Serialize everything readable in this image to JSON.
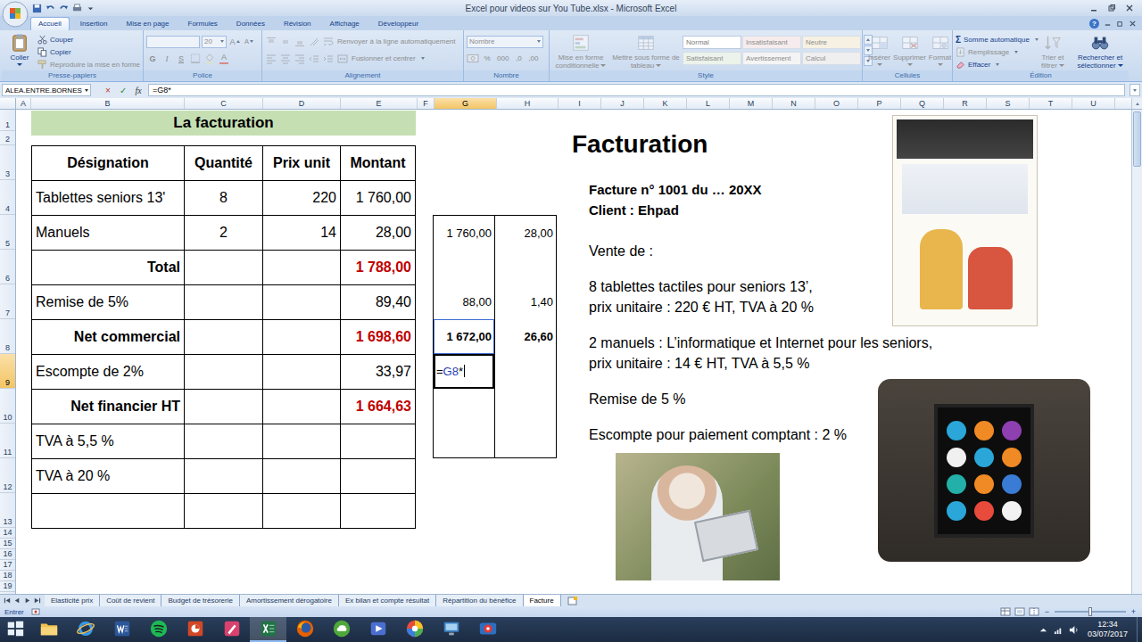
{
  "window": {
    "title": "Excel pour videos sur You Tube.xlsx - Microsoft Excel"
  },
  "ribbon_tabs": [
    {
      "label": "Accueil",
      "selected": true
    },
    {
      "label": "Insertion",
      "selected": false
    },
    {
      "label": "Mise en page",
      "selected": false
    },
    {
      "label": "Formules",
      "selected": false
    },
    {
      "label": "Données",
      "selected": false
    },
    {
      "label": "Révision",
      "selected": false
    },
    {
      "label": "Affichage",
      "selected": false
    },
    {
      "label": "Développeur",
      "selected": false
    }
  ],
  "help": "?",
  "ribbon": {
    "clipboard": {
      "label": "Presse-papiers",
      "paste": {
        "label": "Coller",
        "disabled": false
      },
      "items": [
        {
          "label": "Couper",
          "disabled": false
        },
        {
          "label": "Copier",
          "disabled": false
        },
        {
          "label": "Reproduire la mise en forme",
          "disabled": true
        }
      ]
    },
    "font": {
      "label": "Police",
      "name": "",
      "size": "20",
      "grow": "A",
      "shrink": "A",
      "bold": "G",
      "italic": "I",
      "underline": "S",
      "color_letter": "A",
      "disabled": true
    },
    "alignment": {
      "label": "Alignement",
      "wrap": "Renvoyer à la ligne automatiquement",
      "merge": "Fusionner et centrer",
      "disabled": true
    },
    "number": {
      "label": "Nombre",
      "format": "Nombre",
      "symbols": [
        "%",
        "000",
        ",0",
        ",00"
      ],
      "disabled": true
    },
    "styles": {
      "label": "Style",
      "buttons": [
        "Mise en forme conditionnelle",
        "Mettre sous forme de tableau"
      ],
      "gallery": [
        {
          "label": "Normal",
          "selected": true,
          "color": "#ffffff"
        },
        {
          "label": "Insatisfaisant",
          "selected": false,
          "color": "#f6eced"
        },
        {
          "label": "Neutre",
          "selected": false,
          "color": "#f6f1e2"
        },
        {
          "label": "Satisfaisant",
          "selected": false,
          "color": "#ebf3eb"
        },
        {
          "label": "Avertissement",
          "selected": false,
          "color": "#f4f4f4"
        },
        {
          "label": "Calcul",
          "selected": false,
          "color": "#efefef"
        }
      ],
      "disabled": true
    },
    "cells": {
      "label": "Cellules",
      "buttons": [
        "Insérer",
        "Supprimer",
        "Format"
      ],
      "disabled": true
    },
    "editing": {
      "label": "Édition",
      "sum_symbol": "Σ",
      "items": [
        {
          "label": "Somme automatique",
          "disabled": false
        },
        {
          "label": "Remplissage",
          "disabled": true
        },
        {
          "label": "Effacer",
          "disabled": false
        }
      ],
      "buttons": [
        {
          "label": "Trier et filtrer",
          "disabled": true
        },
        {
          "label": "Rechercher et sélectionner",
          "disabled": false
        }
      ]
    }
  },
  "formula_bar": {
    "name_box": "ALEA.ENTRE.BORNES",
    "cancel": "×",
    "enter": "✓",
    "fx": "fx",
    "formula": "=G8*"
  },
  "columns": [
    {
      "letter": "A",
      "selected": false
    },
    {
      "letter": "B",
      "selected": false
    },
    {
      "letter": "C",
      "selected": false
    },
    {
      "letter": "D",
      "selected": false
    },
    {
      "letter": "E",
      "selected": false
    },
    {
      "letter": "F",
      "selected": false
    },
    {
      "letter": "G",
      "selected": true
    },
    {
      "letter": "H",
      "selected": false
    },
    {
      "letter": "I",
      "selected": false
    },
    {
      "letter": "J",
      "selected": false
    },
    {
      "letter": "K",
      "selected": false
    },
    {
      "letter": "L",
      "selected": false
    },
    {
      "letter": "M",
      "selected": false
    },
    {
      "letter": "N",
      "selected": false
    },
    {
      "letter": "O",
      "selected": false
    },
    {
      "letter": "P",
      "selected": false
    },
    {
      "letter": "Q",
      "selected": false
    },
    {
      "letter": "R",
      "selected": false
    },
    {
      "letter": "S",
      "selected": false
    },
    {
      "letter": "T",
      "selected": false
    },
    {
      "letter": "U",
      "selected": false
    }
  ],
  "rows": [
    {
      "number": "1",
      "selected": false
    },
    {
      "number": "2",
      "selected": false
    },
    {
      "number": "3",
      "selected": false
    },
    {
      "number": "4",
      "selected": false
    },
    {
      "number": "5",
      "selected": false
    },
    {
      "number": "6",
      "selected": false
    },
    {
      "number": "7",
      "selected": false
    },
    {
      "number": "8",
      "selected": false
    },
    {
      "number": "9",
      "selected": true
    },
    {
      "number": "10",
      "selected": false
    },
    {
      "number": "11",
      "selected": false
    },
    {
      "number": "12",
      "selected": false
    },
    {
      "number": "13",
      "selected": false
    },
    {
      "number": "14",
      "selected": false
    },
    {
      "number": "15",
      "selected": false
    },
    {
      "number": "16",
      "selected": false
    },
    {
      "number": "17",
      "selected": false
    },
    {
      "number": "18",
      "selected": false
    },
    {
      "number": "19",
      "selected": false
    }
  ],
  "invoice": {
    "title": "La facturation",
    "rows": [
      {
        "kind": "header",
        "cells": [
          "Désignation",
          "Quantité",
          "Prix unit",
          "Montant"
        ]
      },
      {
        "kind": "item",
        "cells": [
          "Tablettes seniors 13'",
          "8",
          "220",
          "1 760,00"
        ]
      },
      {
        "kind": "item",
        "cells": [
          "Manuels",
          "2",
          "14",
          "28,00"
        ]
      },
      {
        "kind": "total",
        "cells": [
          "Total",
          "",
          "",
          "1 788,00"
        ]
      },
      {
        "kind": "line",
        "cells": [
          "Remise de 5%",
          "",
          "",
          "89,40"
        ]
      },
      {
        "kind": "total",
        "cells": [
          "Net commercial",
          "",
          "",
          "1 698,60"
        ]
      },
      {
        "kind": "line",
        "cells": [
          "Escompte de 2%",
          "",
          "",
          "33,97"
        ]
      },
      {
        "kind": "total",
        "cells": [
          "Net financier HT",
          "",
          "",
          "1 664,63"
        ]
      },
      {
        "kind": "line",
        "cells": [
          "TVA à 5,5 %",
          "",
          "",
          ""
        ]
      },
      {
        "kind": "line",
        "cells": [
          "TVA à 20 %",
          "",
          "",
          ""
        ]
      },
      {
        "kind": "line",
        "cells": [
          "",
          "",
          "",
          ""
        ]
      }
    ]
  },
  "side_table": {
    "rows": [
      {
        "bold": false,
        "cells": [
          {
            "text": "1 760,00",
            "marquee": false,
            "active": false
          },
          {
            "text": "28,00",
            "marquee": false,
            "active": false
          }
        ]
      },
      {
        "bold": false,
        "cells": [
          {
            "text": "",
            "marquee": false,
            "active": false
          },
          {
            "text": "",
            "marquee": false,
            "active": false
          }
        ]
      },
      {
        "bold": false,
        "cells": [
          {
            "text": "88,00",
            "marquee": false,
            "active": false
          },
          {
            "text": "1,40",
            "marquee": false,
            "active": false
          }
        ]
      },
      {
        "bold": true,
        "cells": [
          {
            "text": "1 672,00",
            "marquee": true,
            "active": false
          },
          {
            "text": "26,60",
            "marquee": false,
            "active": false
          }
        ]
      },
      {
        "bold": false,
        "cells": [
          {
            "parts": [
              {
                "text": "=",
                "ref": false
              },
              {
                "text": "G8",
                "ref": true
              },
              {
                "text": "*",
                "ref": false
              }
            ],
            "marquee": false,
            "active": true
          },
          {
            "text": "",
            "marquee": false,
            "active": false
          }
        ]
      },
      {
        "bold": false,
        "cells": [
          {
            "text": "",
            "marquee": false,
            "active": false
          },
          {
            "text": "",
            "marquee": false,
            "active": false
          }
        ]
      },
      {
        "bold": false,
        "cells": [
          {
            "text": "",
            "marquee": false,
            "active": false
          },
          {
            "text": "",
            "marquee": false,
            "active": false
          }
        ]
      }
    ]
  },
  "text_box": {
    "title": "Facturation",
    "header": [
      "Facture n° 1001 du … 20XX",
      "Client : Ehpad"
    ],
    "paragraphs": [
      [
        "Vente de :"
      ],
      [
        "8 tablettes tactiles pour seniors 13’,",
        "prix unitaire : 220 € HT, TVA à 20 %"
      ],
      [
        "2 manuels : L’informatique et Internet pour les seniors,",
        "prix unitaire : 14 € HT, TVA à 5,5 %"
      ],
      [
        "Remise de 5 %"
      ],
      [
        "Escompte pour paiement comptant : 2 %"
      ]
    ]
  },
  "sheet_tabs": [
    {
      "label": "Elasticité prix",
      "selected": false
    },
    {
      "label": "Coût de revient",
      "selected": false
    },
    {
      "label": "Budget de trésorerie",
      "selected": false
    },
    {
      "label": "Amortissement dérogatoire",
      "selected": false
    },
    {
      "label": "Ex bilan et compte résultat",
      "selected": false
    },
    {
      "label": "Répartition du bénéfice",
      "selected": false
    },
    {
      "label": "Facture",
      "selected": true
    }
  ],
  "status_bar": {
    "mode": "Entrer",
    "zoom_out": "−",
    "zoom_in": "+",
    "zoom_level": 0.5
  },
  "taskbar": {
    "apps": [
      {
        "kind": "start",
        "selected": false
      },
      {
        "kind": "folder",
        "selected": false
      },
      {
        "kind": "ie",
        "selected": false
      },
      {
        "kind": "word",
        "selected": false
      },
      {
        "kind": "spotify",
        "selected": false
      },
      {
        "kind": "powerpoint",
        "selected": false
      },
      {
        "kind": "paint",
        "selected": false
      },
      {
        "kind": "excel",
        "selected": true
      },
      {
        "kind": "firefox",
        "selected": false
      },
      {
        "kind": "cloud",
        "selected": false
      },
      {
        "kind": "app",
        "selected": false
      },
      {
        "kind": "picasa",
        "selected": false
      },
      {
        "kind": "monitor",
        "selected": false
      },
      {
        "kind": "camera",
        "selected": false
      }
    ],
    "time": "12:34",
    "date": "03/07/2017"
  }
}
